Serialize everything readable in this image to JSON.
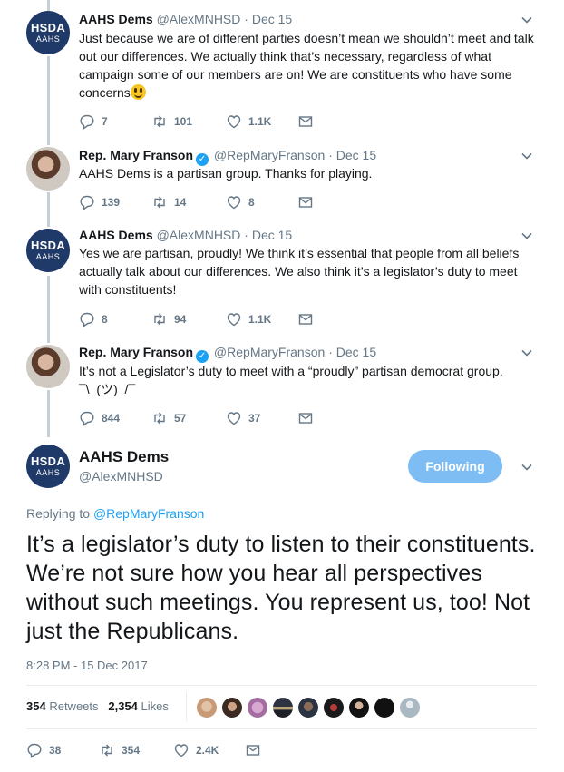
{
  "tweets": [
    {
      "name": "AAHS Dems",
      "handle": "@AlexMNHSD",
      "date": "Dec 15",
      "avatar": "hsda",
      "avatar_l1": "HSDA",
      "avatar_l2": "AAHS",
      "verified": false,
      "text": "Just because we are of different parties doesn’t mean we shouldn’t meet and talk out our differences. We actually think that’s necessary, regardless of what campaign some of our members are on! We are constituents who have some concerns",
      "has_emoji": true,
      "emoji_name": "grinning-face-emoji",
      "replies": "7",
      "retweets": "101",
      "likes": "1.1K"
    },
    {
      "name": "Rep. Mary Franson",
      "handle": "@RepMaryFranson",
      "date": "Dec 15",
      "avatar": "mary",
      "verified": true,
      "text": "AAHS Dems is a partisan group. Thanks for playing.",
      "replies": "139",
      "retweets": "14",
      "likes": "8"
    },
    {
      "name": "AAHS Dems",
      "handle": "@AlexMNHSD",
      "date": "Dec 15",
      "avatar": "hsda",
      "avatar_l1": "HSDA",
      "avatar_l2": "AAHS",
      "verified": false,
      "text": "Yes we are partisan, proudly! We think it’s essential that people from all beliefs actually talk about our differences. We also think it’s a legislator’s duty to meet with constituents!",
      "replies": "8",
      "retweets": "94",
      "likes": "1.1K"
    },
    {
      "name": "Rep. Mary Franson",
      "handle": "@RepMaryFranson",
      "date": "Dec 15",
      "avatar": "mary",
      "verified": true,
      "text": "It’s not a Legislator’s duty to meet with a “proudly” partisan democrat group. ¯\\_(ツ)_/¯",
      "replies": "844",
      "retweets": "57",
      "likes": "37"
    }
  ],
  "main": {
    "name": "AAHS Dems",
    "handle": "@AlexMNHSD",
    "avatar_l1": "HSDA",
    "avatar_l2": "AAHS",
    "follow_label": "Following",
    "replying_prefix": "Replying to",
    "replying_handle": "@RepMaryFranson",
    "text": "It’s a legislator’s duty to listen to their constituents. We’re not sure how you hear all perspectives without such meetings. You represent us, too! Not just the Republicans.",
    "time": "8:28 PM - 15 Dec 2017",
    "retweets_count": "354",
    "retweets_label": "Retweets",
    "likes_count": "2,354",
    "likes_label": "Likes",
    "replies": "38",
    "retweets": "354",
    "likes": "2.4K"
  },
  "colors": {
    "accent": "#1da1f2",
    "follow_button": "#7dbdf4",
    "muted": "#657786",
    "thread_line": "#c4cfd6",
    "avatar_navy": "#1f3a68"
  },
  "icons": {
    "reply": "reply-icon",
    "retweet": "retweet-icon",
    "like": "heart-icon",
    "dm": "envelope-icon",
    "more": "chevron-down-icon",
    "verified": "verified-badge-icon"
  },
  "likers": [
    "liker-1",
    "liker-2",
    "liker-3",
    "liker-4",
    "liker-5",
    "liker-6",
    "liker-7",
    "liker-8",
    "liker-9",
    "liker-10"
  ]
}
